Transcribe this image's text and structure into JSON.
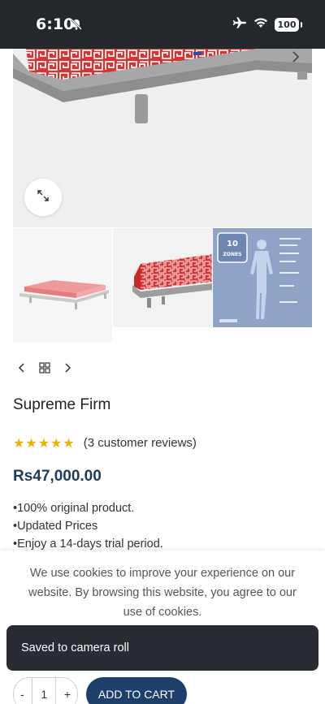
{
  "status_bar": {
    "time": "6:10",
    "battery": "100",
    "icons": [
      "bell-off-icon",
      "airplane-icon",
      "wifi-icon",
      "battery-icon"
    ]
  },
  "gallery": {
    "zoom_icon": "expand-icon",
    "thumbnails": [
      {
        "name": "mattress-on-frame"
      },
      {
        "name": "mattress-side-view"
      },
      {
        "name": "ten-comfort-zones",
        "badge_number": "10",
        "badge_text": "ZONES"
      }
    ],
    "nav_icons": [
      "chevron-left-icon",
      "grid-icon",
      "chevron-right-icon"
    ]
  },
  "product": {
    "title": "Supreme Firm",
    "stars": "★★★★★",
    "rating": 5,
    "review_count": "(3 customer reviews)",
    "price": "Rs47,000.00",
    "features": [
      "100% original product.",
      "Updated Prices",
      "Enjoy a 14-days trial period."
    ]
  },
  "cookie_banner": {
    "text": "We use cookies to improve your experience on our website. By browsing this website, you agree to our use of cookies."
  },
  "toast": {
    "message": "Saved to camera roll"
  },
  "cart": {
    "decrement": "-",
    "quantity": "1",
    "increment": "+",
    "add_to_cart_label": "ADD TO CART"
  },
  "colors": {
    "accent": "#1e3f6b",
    "price": "#1f3c5b",
    "stars": "#e8b10f",
    "status_bar": "#24272b",
    "toast": "#2a2c33"
  }
}
